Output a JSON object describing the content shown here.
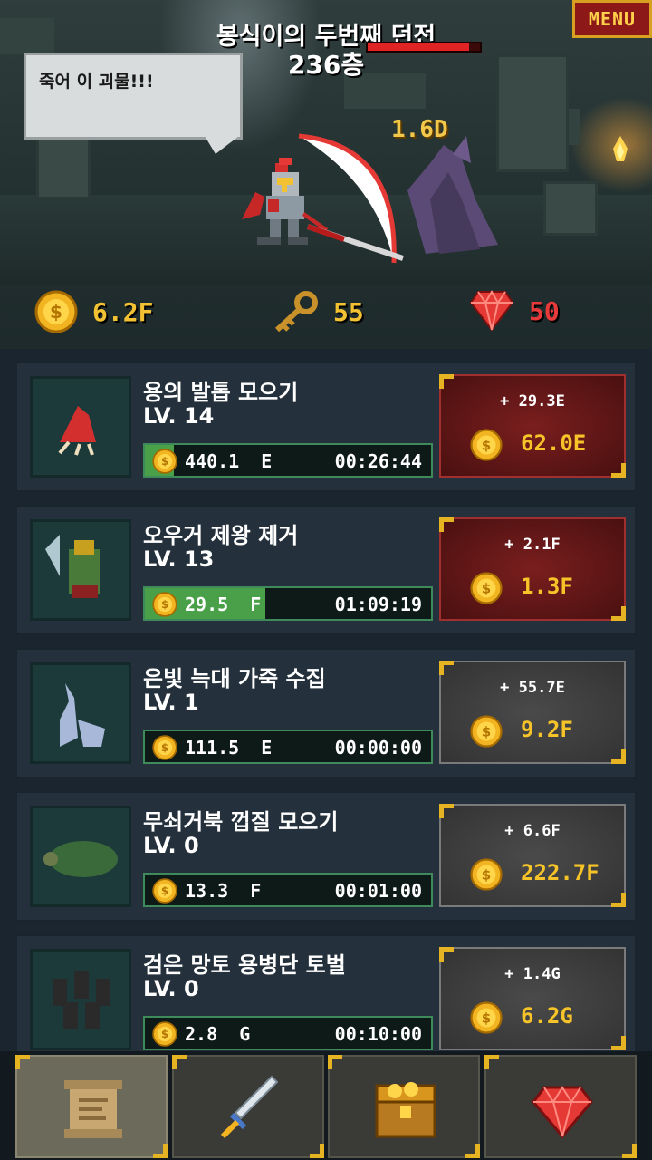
{
  "header": {
    "dungeon_name": "봉식이의 두번째 던전",
    "floor": "236층",
    "menu_label": "MENU",
    "enemy_hp_fraction": 0.9
  },
  "battle": {
    "speech": "죽어 이 괴물!!!",
    "damage": "1.6D"
  },
  "resources": {
    "gold": "6.2F",
    "keys": "55",
    "gems": "50"
  },
  "quests": [
    {
      "name": "용의 발톱 모으기",
      "level": "LV. 14",
      "reward": "440.1  E",
      "timer": "00:26:44",
      "progress": 0.1,
      "bonus": "+ 29.3E",
      "cost": "62.0E",
      "affordable": true
    },
    {
      "name": "오우거 제왕 제거",
      "level": "LV. 13",
      "reward": "29.5  F",
      "timer": "01:09:19",
      "progress": 0.42,
      "bonus": "+ 2.1F",
      "cost": "1.3F",
      "affordable": true
    },
    {
      "name": "은빛 늑대 가죽 수집",
      "level": "LV. 1",
      "reward": "111.5  E",
      "timer": "00:00:00",
      "progress": 0,
      "bonus": "+ 55.7E",
      "cost": "9.2F",
      "affordable": false
    },
    {
      "name": "무쇠거북 껍질 모으기",
      "level": "LV. 0",
      "reward": "13.3  F",
      "timer": "00:01:00",
      "progress": 0,
      "bonus": "+ 6.6F",
      "cost": "222.7F",
      "affordable": false
    },
    {
      "name": "검은 망토 용병단 토벌",
      "level": "LV. 0",
      "reward": "2.8  G",
      "timer": "00:10:00",
      "progress": 0,
      "bonus": "+ 1.4G",
      "cost": "6.2G",
      "affordable": false
    }
  ],
  "tabs": [
    {
      "icon": "scroll-icon",
      "active": true
    },
    {
      "icon": "sword-icon",
      "active": false
    },
    {
      "icon": "treasure-chest-icon",
      "active": false
    },
    {
      "icon": "gem-icon",
      "active": false
    }
  ],
  "colors": {
    "gold": "#f2c233",
    "gem": "#e83a3a",
    "accent_corner": "#e6b422",
    "affordable_button": "#7a1e1e",
    "locked_button": "#4a4a4a"
  }
}
